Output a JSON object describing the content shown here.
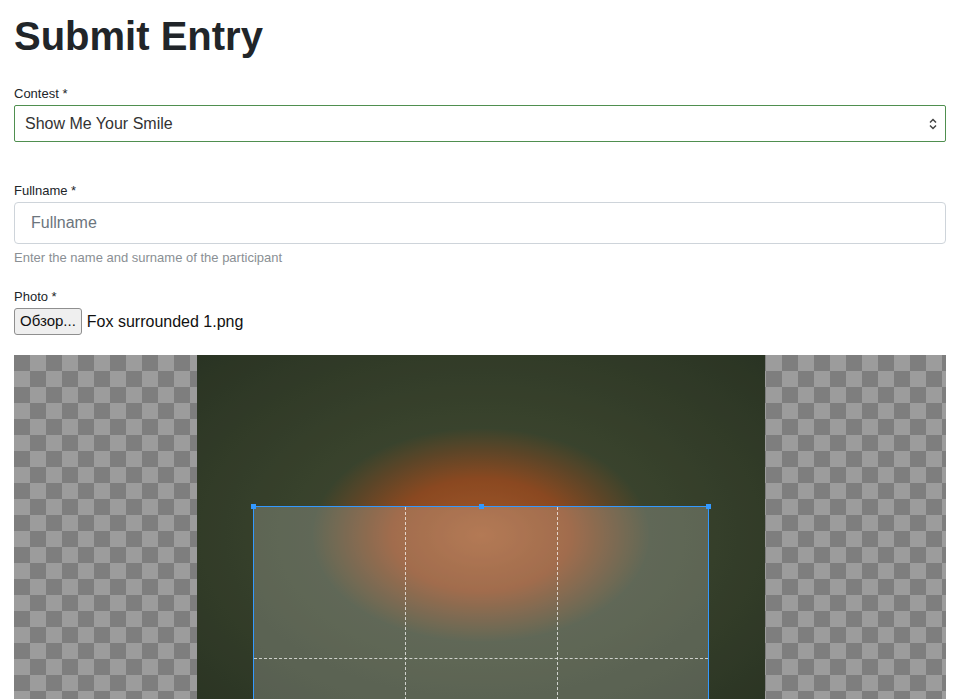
{
  "title": "Submit Entry",
  "contest": {
    "label": "Contest *",
    "value": "Show Me Your Smile"
  },
  "fullname": {
    "label": "Fullname *",
    "placeholder": "Fullname",
    "help": "Enter the name and surname of the participant"
  },
  "photo": {
    "label": "Photo *",
    "button": "Обзор...",
    "filename": "Fox surrounded 1.png"
  }
}
